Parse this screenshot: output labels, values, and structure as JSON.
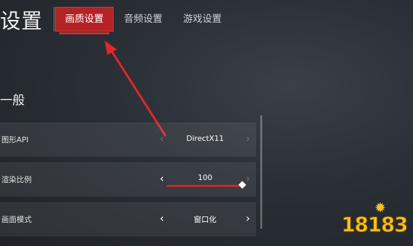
{
  "header": {
    "title": "设置",
    "tabs": [
      {
        "label": "画质设置",
        "active": true
      },
      {
        "label": "音频设置",
        "active": false
      },
      {
        "label": "游戏设置",
        "active": false
      }
    ]
  },
  "section": {
    "title": "一般"
  },
  "settings": [
    {
      "label": "图形API",
      "value": "DirectX11"
    },
    {
      "label": "渲染比例",
      "value": "100",
      "slider_level": 1.0
    },
    {
      "label": "画面模式",
      "value": "窗口化"
    }
  ],
  "colors": {
    "accent": "#b42326",
    "slider": "#c62a2d",
    "watermark": "#f6c31d"
  },
  "icons": {
    "prev": "chevron-left-icon",
    "next": "chevron-right-icon"
  },
  "watermark": {
    "text": "18183"
  }
}
